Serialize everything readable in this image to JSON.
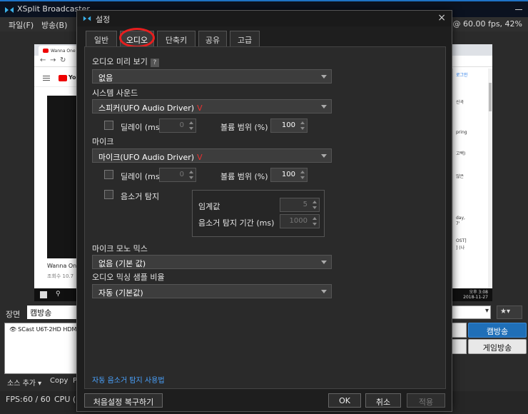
{
  "main": {
    "title": "XSplit Broadcaster",
    "menu": [
      "파일(F)",
      "방송(B)"
    ],
    "fps_text": "@ 60.00 fps, 42%",
    "scene_label": "장면",
    "scene_name": "캠방송",
    "source_item": "SCast U6T-2HD HDM",
    "source_add": "소스 추가 ▾",
    "source_copy": "Copy",
    "source_more": "P",
    "stream_primary": "캠방송",
    "stream_secondary": "게임방송",
    "status_fps_label": "FPS:",
    "status_fps_value": "60 / 60",
    "status_cpu": "CPU (",
    "preview": {
      "tab_text": "Wanna One (워너원)...",
      "yt_text": "You",
      "video_title": "Wanna One",
      "views": "조회수 10.7",
      "login": "로그인",
      "right_lines": [
        "신곡",
        "",
        "pring",
        "",
        "고백)",
        "",
        "않은",
        "",
        "day,",
        "7'",
        "OST]",
        "] (나"
      ],
      "clock_line1": "오후 3:08",
      "clock_line2": "2018-11-27"
    }
  },
  "dialog": {
    "title": "설정",
    "close": "×",
    "tabs": [
      "일반",
      "오디오",
      "단축키",
      "공유",
      "고급"
    ],
    "audio_preview_label": "오디오 미리 보기",
    "help": "?",
    "audio_preview_value": "없음",
    "system_sound_label": "시스템 사운드",
    "system_sound_value": "스피커(UFO Audio Driver)",
    "red_v": "V",
    "delay_label": "딜레이 (ms)",
    "delay_value": "0",
    "volume_label": "볼륨 범위 (%)",
    "volume_value": "100",
    "mic_label": "마이크",
    "mic_value": "마이크(UFO Audio Driver)",
    "mic_delay_value": "0",
    "mic_volume_value": "100",
    "noise_detect_label": "음소거 탐지",
    "threshold_label": "임계값",
    "threshold_value": "5",
    "noise_duration_label": "음소거 탐지 기간 (ms)",
    "noise_duration_value": "1000",
    "mono_mix_label": "마이크 모노 믹스",
    "mono_mix_value": "없음 (기본 값)",
    "sample_rate_label": "오디오 믹싱 샘플 비율",
    "sample_rate_value": "자동 (기본값)",
    "help_link": "자동 음소거 탐지 사용법",
    "reset_button": "처음설정 복구하기",
    "ok_button": "OK",
    "cancel_button": "취소",
    "apply_button": "적용"
  }
}
